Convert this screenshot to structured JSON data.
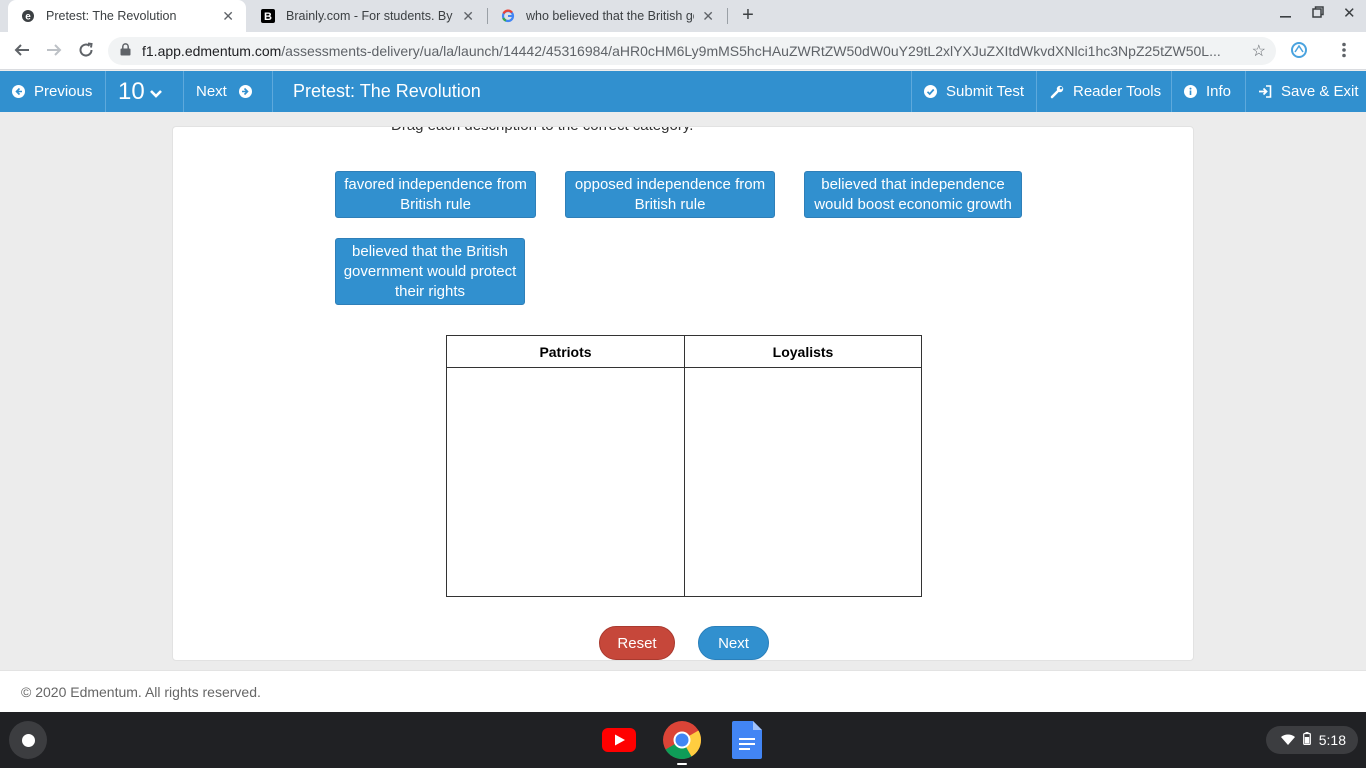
{
  "browser": {
    "tabs": [
      {
        "title": "Pretest: The Revolution",
        "active": true,
        "favicon": "edmentum-e-icon"
      },
      {
        "title": "Brainly.com - For students. By students",
        "active": false,
        "favicon": "brainly-b-icon"
      },
      {
        "title": "who believed that the British gov",
        "active": false,
        "favicon": "google-g-icon"
      }
    ],
    "url_host": "f1.app.edmentum.com",
    "url_path": "/assessments-delivery/ua/la/launch/14442/45316984/aHR0cHM6Ly9mMS5hcHAuZWRtZW50dW0uY29tL2xlYXJuZXItdWkvdXNlci1hc3NpZ25tZW50L..."
  },
  "nav": {
    "previous": "Previous",
    "question_number": "10",
    "next": "Next",
    "page_title": "Pretest: The Revolution",
    "submit": "Submit Test",
    "reader_tools": "Reader Tools",
    "info": "Info",
    "save_exit": "Save & Exit"
  },
  "question": {
    "partial_text": "Drag each description to the correct category."
  },
  "tiles": [
    {
      "text": "favored independence from British rule"
    },
    {
      "text": "opposed independence from British rule"
    },
    {
      "text": "believed that independence would boost economic growth"
    },
    {
      "text": "believed that the British government would protect their rights"
    }
  ],
  "table": {
    "col1": "Patriots",
    "col2": "Loyalists"
  },
  "buttons": {
    "reset": "Reset",
    "next": "Next"
  },
  "footer": {
    "copyright": "© 2020 Edmentum. All rights reserved."
  },
  "shelf": {
    "time": "5:18",
    "apps": [
      "youtube-icon",
      "chrome-icon",
      "google-docs-icon"
    ]
  },
  "colors": {
    "brand_blue": "#3190cf",
    "reset_red": "#c6473a"
  }
}
